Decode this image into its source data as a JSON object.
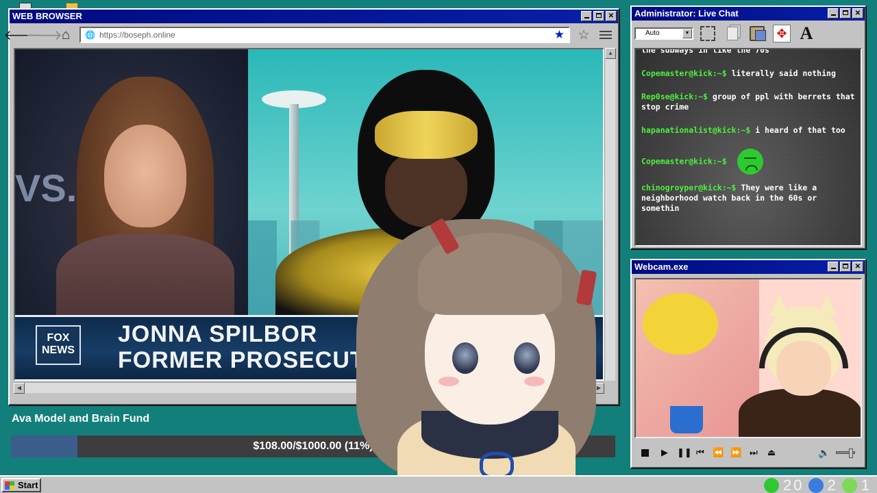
{
  "browser": {
    "title": "WEB BROWSER",
    "url": "https://boseph.online",
    "video": {
      "lower_third_name": "JONNA SPILBOR",
      "lower_third_title": "FORMER PROSECUT",
      "channel_logo": "FOX NEWS",
      "side_text": "VS."
    }
  },
  "chat": {
    "title": "Administrator: Live Chat",
    "font_select": "Auto",
    "messages": [
      {
        "user": "",
        "text": "the subways in like the 70s"
      },
      {
        "user": "Copemaster@kick:~$",
        "text": "literally said nothing"
      },
      {
        "user": "Rep0se@kick:~$",
        "text": "group of ppl with berrets that stop crime"
      },
      {
        "user": "hapanationalist@kick:~$",
        "text": "i heard of that too"
      },
      {
        "user": "Copemaster@kick:~$",
        "text": "",
        "emote": "sad-green-face-emote"
      },
      {
        "user": "chinogroyper@kick:~$",
        "text": "They were like a neighborhood watch back in the 60s or somethin"
      }
    ]
  },
  "webcam": {
    "title": "Webcam.exe"
  },
  "fund": {
    "label": "Ava Model and Brain Fund",
    "progress_text": "$108.00/$1000.00 (11%)",
    "progress_fraction": 0.11
  },
  "taskbar": {
    "start_label": "Start",
    "tray_count_1": "20",
    "tray_count_2": "2",
    "tray_count_3": "1"
  },
  "colors": {
    "desktop": "#127f7a",
    "titlebar": "#000a80",
    "chat_username": "#4cf03c",
    "fund_fill": "#3b5d8c"
  }
}
